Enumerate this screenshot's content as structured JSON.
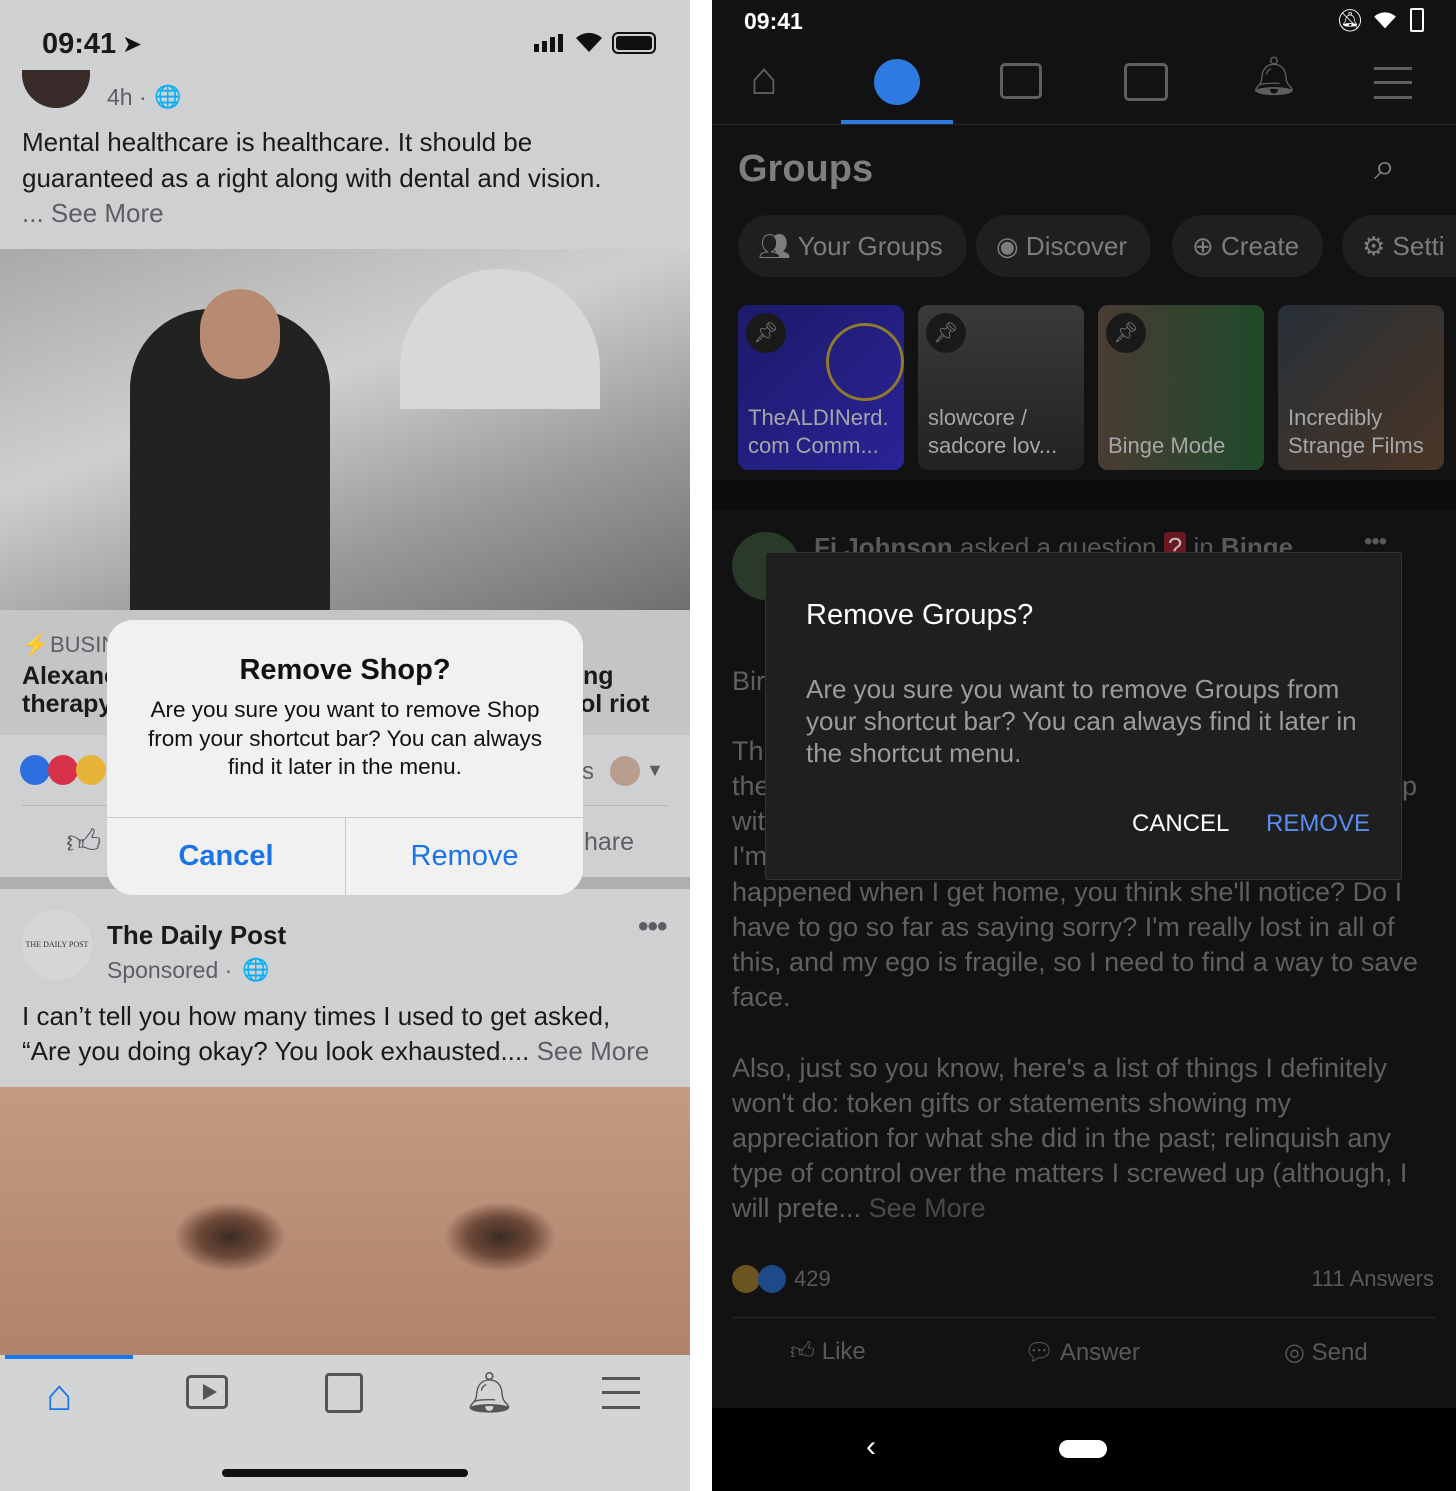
{
  "ios": {
    "status": {
      "time": "09:41"
    },
    "post1": {
      "meta": "4h ·",
      "text_lines": [
        "Mental healthcare is healthcare. It should be",
        "guaranteed as a right along with dental and vision."
      ],
      "see_more": "... See More",
      "link": {
        "category_fragment": "BUSIN",
        "title_left": [
          "Alexanc",
          "therapy"
        ],
        "title_right": [
          "ng",
          "ol riot"
        ]
      },
      "reactions_suffix": "s",
      "share_fragment": "hare"
    },
    "post2": {
      "page_logo_text": "THE DAILY POST",
      "author": "The Daily Post",
      "meta": "Sponsored ·",
      "text_lines": [
        "I can’t tell you how many times I used to get asked,",
        "“Are you doing okay? You look exhausted...."
      ],
      "see_more": "See More"
    },
    "tabbar": {
      "items": [
        "home-icon",
        "video-icon",
        "shop-icon",
        "bell-icon",
        "menu-icon"
      ],
      "active": "home"
    },
    "dialog": {
      "title": "Remove Shop?",
      "message": "Are you sure you want to remove Shop from your shortcut bar? You can always find it later in the menu.",
      "cancel": "Cancel",
      "remove": "Remove"
    },
    "accent": "#1877f2"
  },
  "android": {
    "status": {
      "time": "09:41"
    },
    "nav": {
      "items": [
        "home-icon",
        "groups-icon",
        "video-icon",
        "news-icon",
        "bell-icon",
        "menu-icon"
      ],
      "active": "groups"
    },
    "header": {
      "title": "Groups"
    },
    "pills": [
      "Your Groups",
      "Discover",
      "Create",
      "Setti"
    ],
    "cards": [
      {
        "label": "TheALDINerd.\ncom Comm..."
      },
      {
        "label": "slowcore /\nsadcore lov..."
      },
      {
        "label": "Binge Mode"
      },
      {
        "label": "Incredibly\nStrange Films"
      }
    ],
    "post": {
      "author": "Fi Johnson",
      "action": "asked a question",
      "in": "in",
      "group": "Binge",
      "fragments": [
        "Bir",
        "Th",
        "the",
        "wit",
        "I'm",
        "p"
      ],
      "body_lines": [
        "happened when I get home, you think she'll notice? Do I",
        "have to go so far as saying sorry? I'm really lost in all of",
        "this, and my ego is fragile, so I need to find a way to save",
        "face.",
        "",
        "Also, just so you know, here's a list of things I definitely",
        "won't do: token gifts or statements showing my",
        "appreciation for what she did in the past; relinquish any",
        "type of control over the matters I screwed up (although, I"
      ],
      "last_line": "will prete...",
      "see_more": "See More",
      "reaction_count": "429",
      "answers": "111 Answers",
      "actions": [
        "Like",
        "Answer",
        "Send"
      ]
    },
    "dialog": {
      "title": "Remove Groups?",
      "message": "Are you sure you want to remove Groups from your shortcut bar? You can always find it later in the shortcut menu.",
      "cancel": "CANCEL",
      "remove": "REMOVE"
    },
    "accent": "#5b8def"
  }
}
